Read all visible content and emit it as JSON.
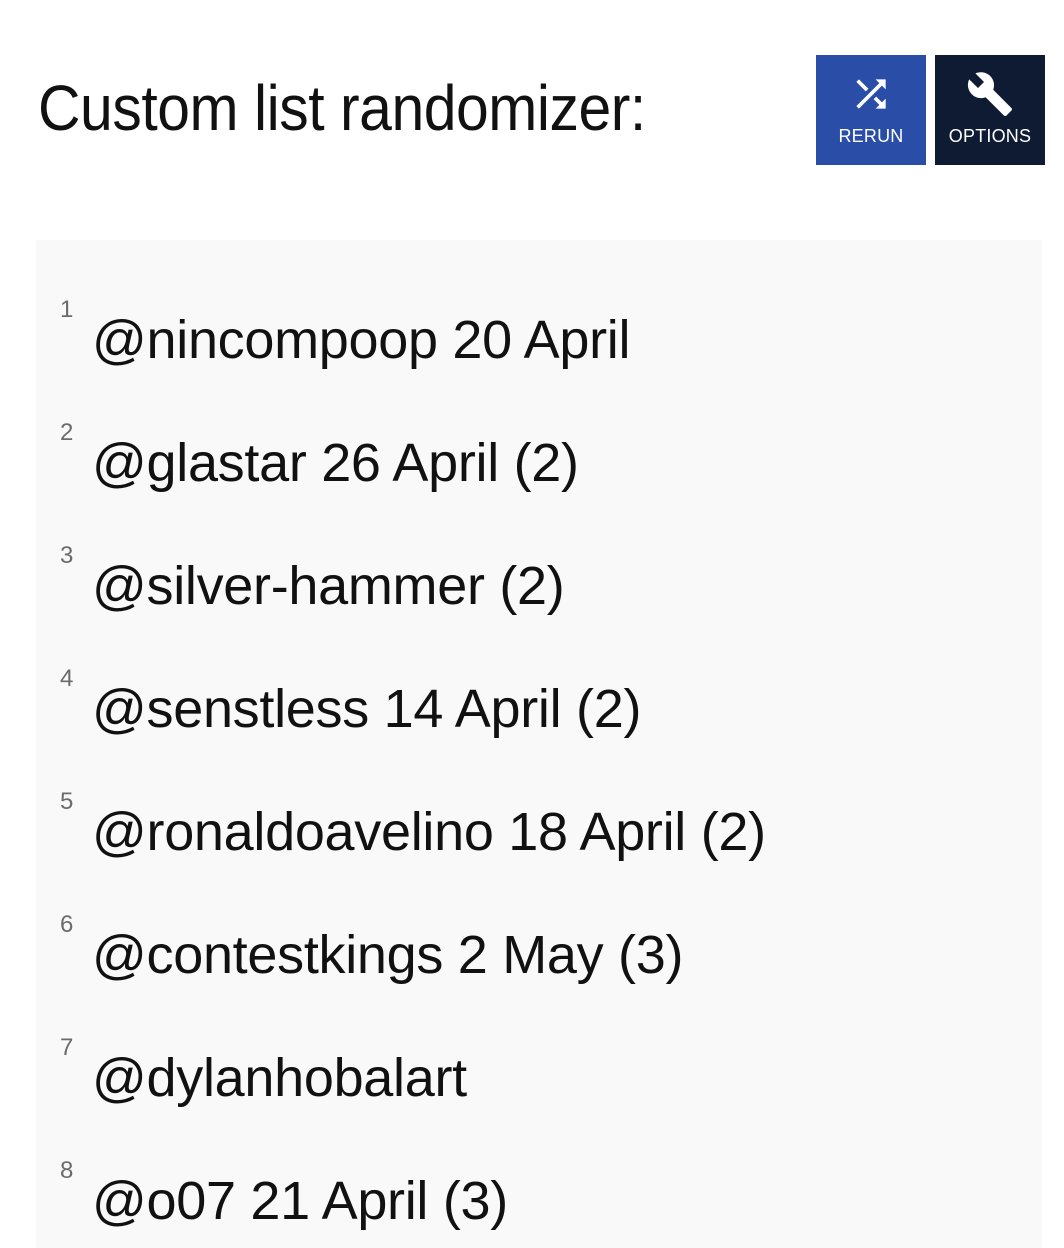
{
  "header": {
    "title": "Custom list randomizer:",
    "rerun": {
      "label": "RERUN",
      "icon": "shuffle-icon",
      "color": "#2a4ea8"
    },
    "options": {
      "label": "OPTIONS",
      "icon": "wrench-icon",
      "color": "#0f1b33"
    }
  },
  "list": {
    "background": "#f9f9f9",
    "items": [
      {
        "number": "1",
        "text": "@nincompoop 20 April"
      },
      {
        "number": "2",
        "text": "@glastar 26 April (2)"
      },
      {
        "number": "3",
        "text": "@silver-hammer (2)"
      },
      {
        "number": "4",
        "text": "@senstless 14 April (2)"
      },
      {
        "number": "5",
        "text": "@ronaldoavelino 18 April (2)"
      },
      {
        "number": "6",
        "text": "@contestkings 2 May (3)"
      },
      {
        "number": "7",
        "text": "@dylanhobalart"
      },
      {
        "number": "8",
        "text": "@o07 21 April (3)"
      }
    ]
  }
}
